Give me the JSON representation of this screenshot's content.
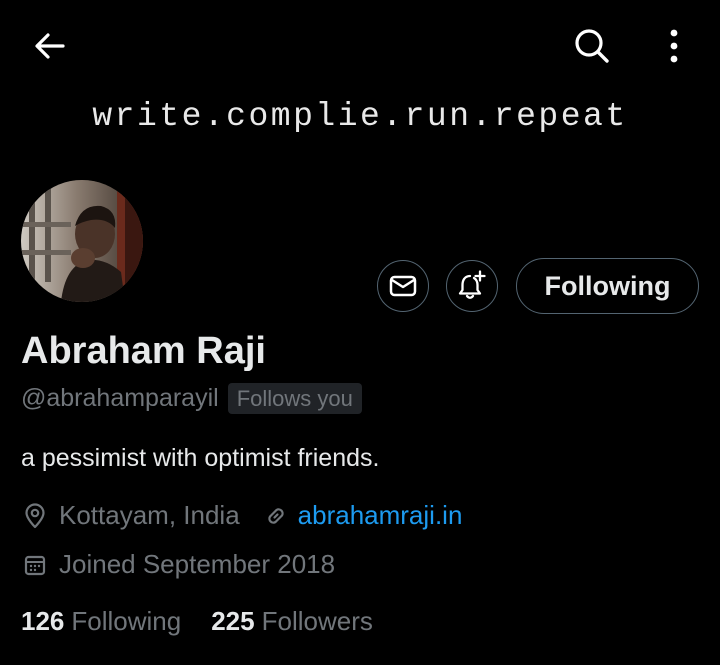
{
  "header": {
    "banner_text": "write.complie.run.repeat"
  },
  "profile": {
    "name": "Abraham Raji",
    "handle": "@abrahamparayil",
    "follows_you": "Follows you",
    "bio": "a pessimist with optimist friends.",
    "location": "Kottayam, India",
    "website": "abrahamraji.in",
    "joined": "Joined September 2018"
  },
  "actions": {
    "following_label": "Following"
  },
  "stats": {
    "following_count": "126",
    "following_label": "Following",
    "followers_count": "225",
    "followers_label": "Followers"
  },
  "colors": {
    "background": "#000000",
    "text_primary": "#e7e9ea",
    "text_secondary": "#71767b",
    "link": "#1d9bf0",
    "border": "#536471",
    "badge_bg": "#202327"
  }
}
